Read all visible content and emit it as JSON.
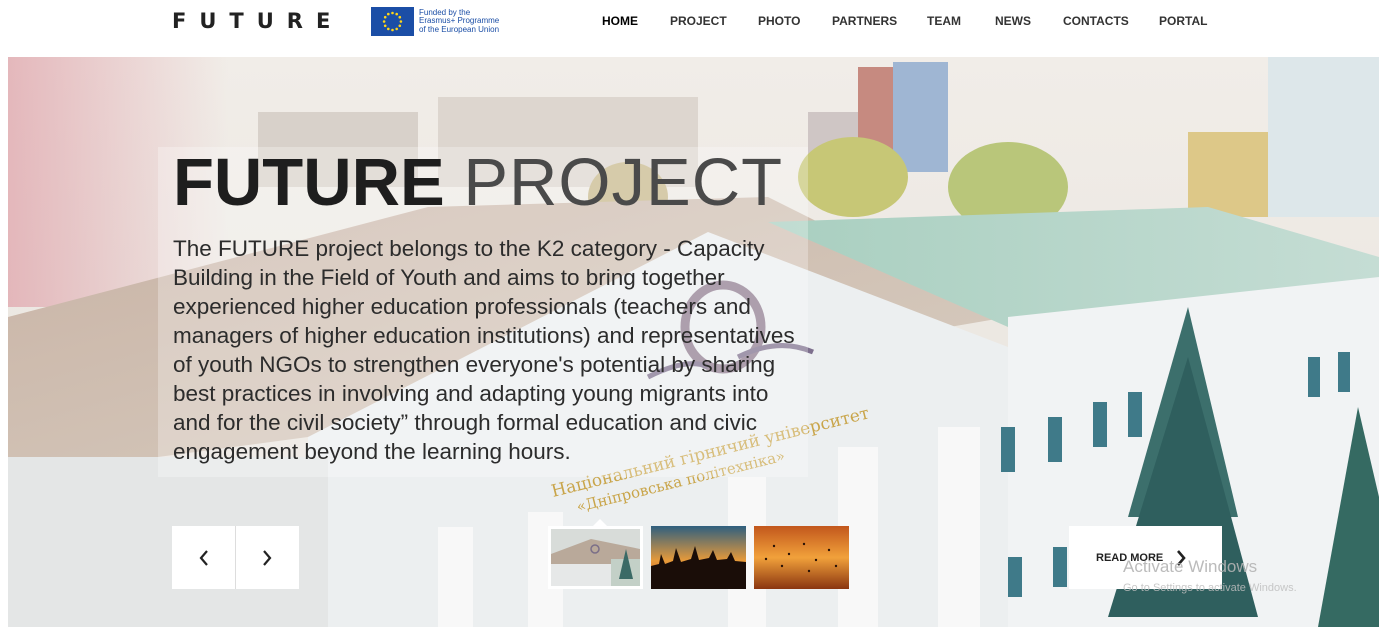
{
  "header": {
    "logo": "FUTURE",
    "eu_badge": {
      "line1": "Funded by the",
      "line2": "Erasmus+ Programme",
      "line3": "of the European Union"
    },
    "nav": [
      {
        "label": "HOME",
        "active": true
      },
      {
        "label": "PROJECT",
        "active": false
      },
      {
        "label": "PHOTO",
        "active": false
      },
      {
        "label": "PARTNERS",
        "active": false
      },
      {
        "label": "TEAM",
        "active": false
      },
      {
        "label": "NEWS",
        "active": false
      },
      {
        "label": "CONTACTS",
        "active": false
      },
      {
        "label": "PORTAL",
        "active": false
      }
    ]
  },
  "hero": {
    "title_bold": "FUTURE",
    "title_thin": "PROJECT",
    "description": "The FUTURE project belongs to the K2 category - Capacity Building in the Field of Youth and aims to bring together experienced higher education professionals (teachers and managers of higher education institutions) and representatives of youth NGOs to strengthen everyone's potential by sharing best practices in involving and adapting young migrants into and for the civil society” through formal education and civic engagement beyond the learning hours.",
    "building_sign_line1": "Національний гірничий університет",
    "building_sign_line2": "«Дніпровська політехніка»",
    "prev_icon": "chevron-left-icon",
    "next_icon": "chevron-right-icon",
    "thumbnails": [
      {
        "name": "university-building",
        "active": true
      },
      {
        "name": "crowd-sunset",
        "active": false
      },
      {
        "name": "birds-sunset",
        "active": false
      }
    ],
    "read_more_label": "READ MORE",
    "read_more_icon": "chevron-right-icon"
  },
  "os_watermark": {
    "title": "Activate Windows",
    "subtitle": "Go to Settings to activate Windows."
  },
  "colors": {
    "eu_blue": "#1b4ea6",
    "eu_star": "#ffd617",
    "text_dark": "#1e1e1e"
  }
}
